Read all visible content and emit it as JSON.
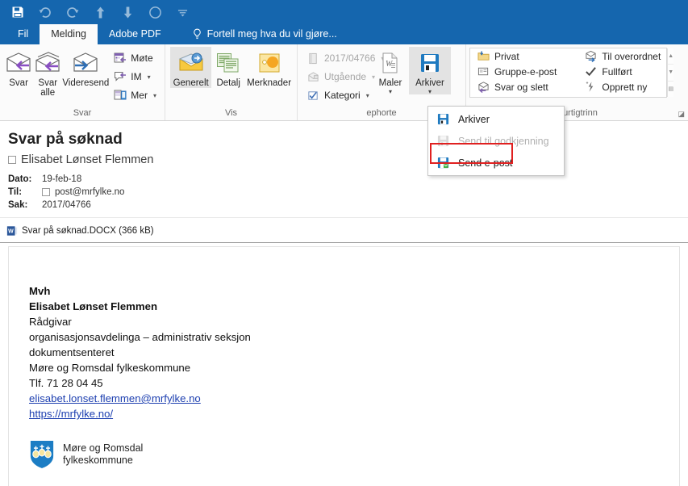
{
  "quick_access": {
    "items": [
      {
        "name": "save-icon",
        "label": "Lagre",
        "state": "active"
      },
      {
        "name": "undo-icon",
        "label": "Angre",
        "state": "dim"
      },
      {
        "name": "redo-icon",
        "label": "Gjør om",
        "state": "dim"
      },
      {
        "name": "previous-item-icon",
        "label": "Forrige element",
        "state": "dim"
      },
      {
        "name": "next-item-icon",
        "label": "Neste element",
        "state": "dim"
      },
      {
        "name": "circle-icon",
        "label": "Merk",
        "state": "dim"
      },
      {
        "name": "customize-qat-icon",
        "label": "Tilpass verktøylinje",
        "state": "dim"
      }
    ]
  },
  "tabs": {
    "items": [
      {
        "label": "Fil",
        "selected": false
      },
      {
        "label": "Melding",
        "selected": true
      },
      {
        "label": "Adobe PDF",
        "selected": false
      }
    ],
    "tell_me": "Fortell meg hva du vil gjøre..."
  },
  "ribbon": {
    "groups": [
      {
        "title": "Svar",
        "big_buttons": [
          {
            "label": "Svar",
            "icon": "reply-icon"
          },
          {
            "label": "Svar alle",
            "icon": "reply-all-icon"
          },
          {
            "label": "Videresend",
            "icon": "forward-icon"
          }
        ],
        "small_buttons": [
          {
            "label": "Møte",
            "icon": "meeting-icon",
            "caret": false,
            "dim": false
          },
          {
            "label": "IM",
            "icon": "im-icon",
            "caret": true,
            "dim": false
          },
          {
            "label": "Mer",
            "icon": "more-icon",
            "caret": true,
            "dim": false
          }
        ]
      },
      {
        "title": "Vis",
        "big_buttons": [
          {
            "label": "Generelt",
            "icon": "general-icon",
            "pressed": true
          },
          {
            "label": "Detalj",
            "icon": "details-icon",
            "pressed": false
          },
          {
            "label": "Merknader",
            "icon": "notes-icon",
            "pressed": false
          }
        ],
        "small_buttons": []
      },
      {
        "title": "ephorte",
        "big_buttons": [
          {
            "label": "Maler",
            "icon": "templates-icon",
            "caret": true
          }
        ],
        "small_buttons": [
          {
            "label": "2017/04766",
            "icon": "case-icon",
            "caret": true,
            "dim": true
          },
          {
            "label": "Utgående",
            "icon": "outgoing-icon",
            "caret": true,
            "dim": true
          },
          {
            "label": "Kategori",
            "icon": "category-icon",
            "caret": true,
            "dim": false
          }
        ],
        "archive_button": {
          "label": "Arkiver",
          "icon": "archive-icon",
          "pressed": true,
          "has_dropdown": true
        }
      },
      {
        "title": "Hurtigtrinn",
        "gallery": [
          {
            "label": "Privat",
            "icon": "private-folder-icon"
          },
          {
            "label": "Gruppe-e-post",
            "icon": "group-email-icon"
          },
          {
            "label": "Svar og slett",
            "icon": "reply-delete-icon"
          },
          {
            "label": "Til overordnet",
            "icon": "to-manager-icon"
          },
          {
            "label": "Fullført",
            "icon": "done-check-icon"
          },
          {
            "label": "Opprett ny",
            "icon": "create-new-icon"
          }
        ],
        "scroll_buttons": [
          {
            "name": "gallery-scroll-up",
            "glyph": "▲"
          },
          {
            "name": "gallery-scroll-down",
            "glyph": "▼"
          },
          {
            "name": "gallery-more",
            "glyph": "▤"
          }
        ],
        "dialog_launcher": "⌐"
      }
    ]
  },
  "archive_menu": {
    "items": [
      {
        "label": "Arkiver",
        "icon": "archive-icon",
        "disabled": false,
        "highlighted": false
      },
      {
        "label": "Send til godkjenning",
        "icon": "archive-approve-icon",
        "disabled": true,
        "highlighted": false
      },
      {
        "label": "Send e-post",
        "icon": "archive-email-icon",
        "disabled": false,
        "highlighted": true
      }
    ]
  },
  "mail": {
    "subject": "Svar på søknad",
    "sender": "Elisabet Lønset Flemmen",
    "fields": [
      {
        "label": "Dato:",
        "value": "19-feb-18",
        "checkbox": false
      },
      {
        "label": "Til:",
        "value": "post@mrfylke.no",
        "checkbox": true
      },
      {
        "label": "Sak:",
        "value": "2017/04766",
        "checkbox": false
      }
    ],
    "attachment": {
      "name": "Svar på søknad.DOCX (366 kB)",
      "icon": "word-doc-icon"
    },
    "body": {
      "lines": [
        {
          "text": "Mvh",
          "bold": true,
          "link": false
        },
        {
          "text": "Elisabet Lønset Flemmen",
          "bold": true,
          "link": false
        },
        {
          "text": "Rådgivar",
          "bold": false,
          "link": false
        },
        {
          "text": "organisasjonsavdelinga – administrativ seksjon",
          "bold": false,
          "link": false
        },
        {
          "text": "dokumentsenteret",
          "bold": false,
          "link": false
        },
        {
          "text": "Møre og Romsdal fylkeskommune",
          "bold": false,
          "link": false
        },
        {
          "text": "Tlf. 71 28 04 45",
          "bold": false,
          "link": false
        },
        {
          "text": "elisabet.lonset.flemmen@mrfylke.no",
          "bold": false,
          "link": true
        },
        {
          "text": "https://mrfylke.no/",
          "bold": false,
          "link": true
        }
      ],
      "logo": {
        "icon": "more-og-romsdal-crest-icon",
        "line1": "Møre og Romsdal",
        "line2": "fylkeskommune"
      }
    }
  },
  "colors": {
    "ribbon_blue": "#1566ae",
    "highlight_red": "#e02020",
    "link_blue": "#1d3fb0",
    "crest_blue": "#1c7dc4"
  }
}
